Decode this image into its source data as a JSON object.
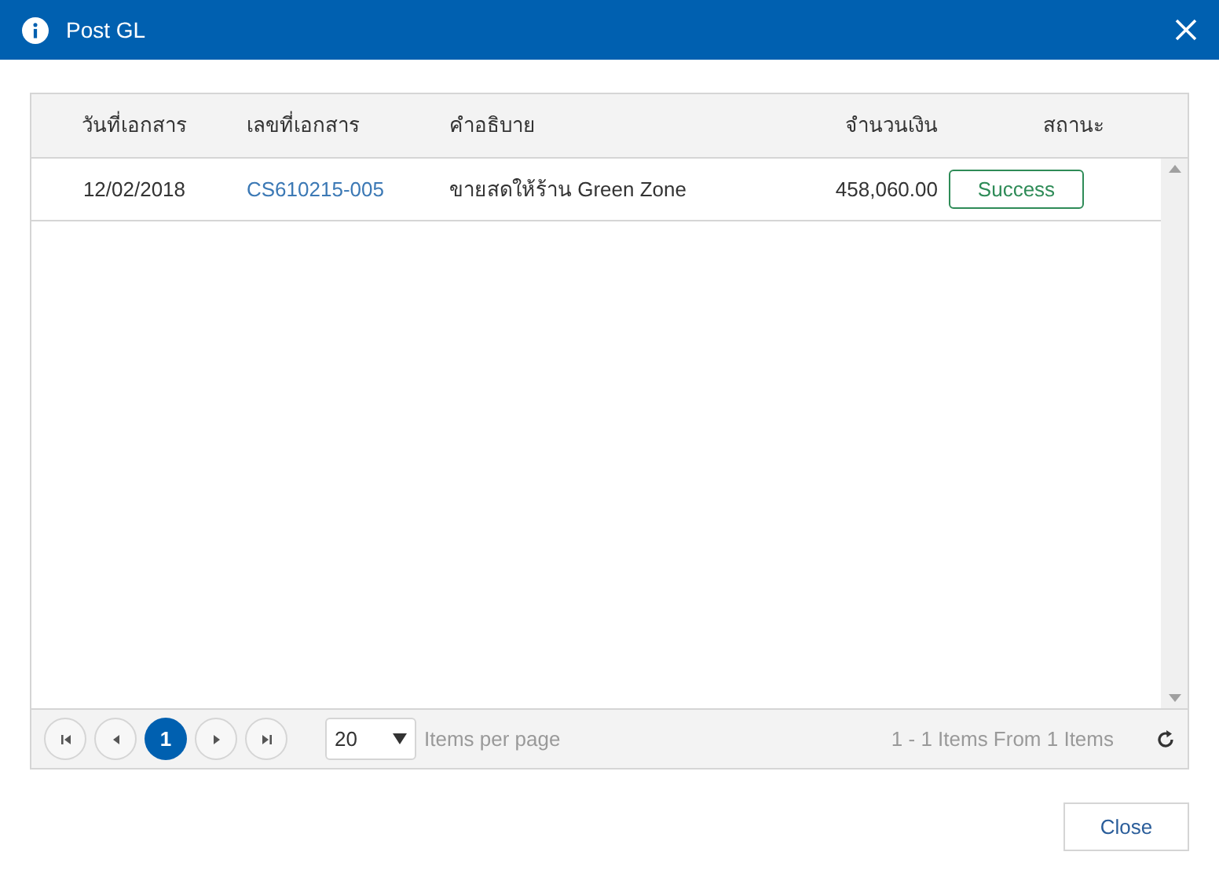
{
  "window": {
    "title": "Post GL"
  },
  "table": {
    "columns": [
      "วันที่เอกสาร",
      "เลขที่เอกสาร",
      "คำอธิบาย",
      "จำนวนเงิน",
      "สถานะ"
    ],
    "rows": [
      {
        "date": "12/02/2018",
        "doc_no": "CS610215-005",
        "description": "ขายสดให้ร้าน Green Zone",
        "amount": "458,060.00",
        "status": "Success"
      }
    ]
  },
  "pager": {
    "pages": [
      {
        "label": "1",
        "selected": true
      }
    ],
    "page_size": "20",
    "page_size_label": "Items per page",
    "summary": "1 - 1 Items From 1 Items"
  },
  "buttons": [
    "Close"
  ]
}
